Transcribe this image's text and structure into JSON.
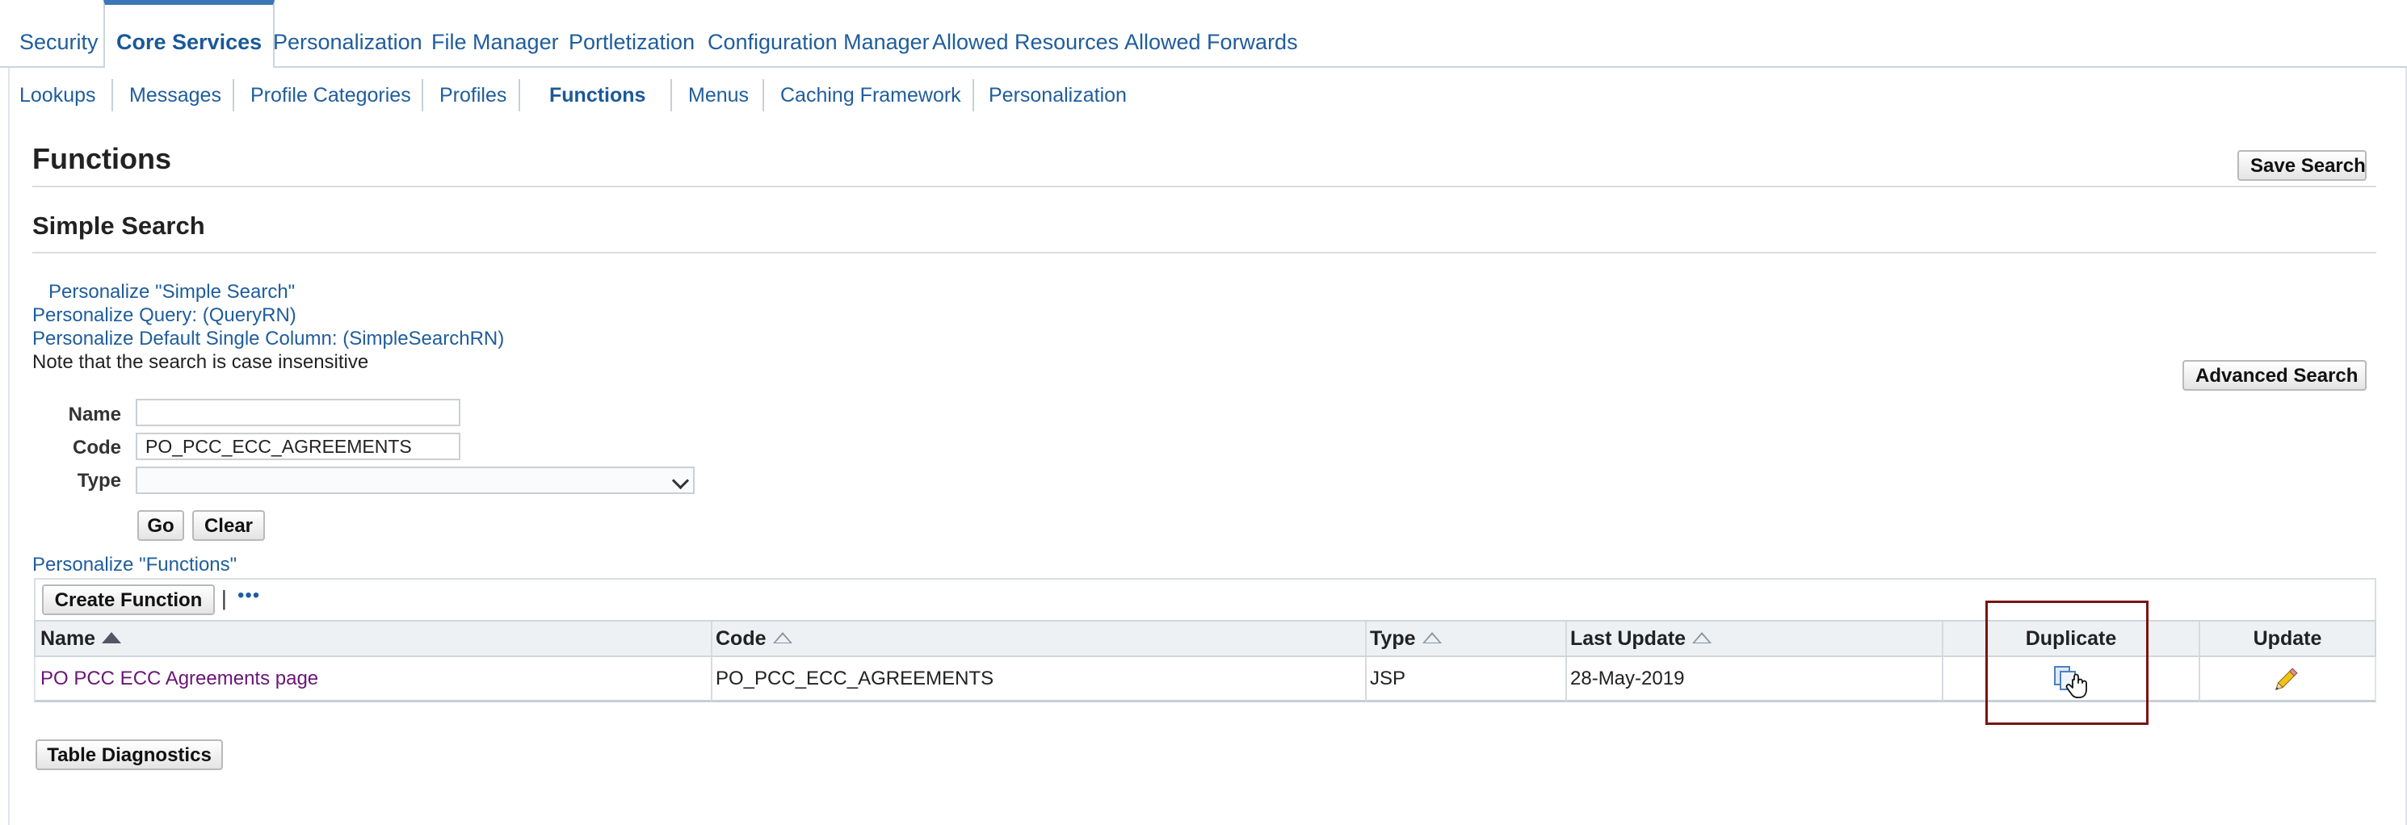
{
  "top_tabs": [
    "Security",
    "Core Services",
    "Personalization",
    "File Manager",
    "Portletization",
    "Configuration Manager",
    "Allowed Resources",
    "Allowed Forwards"
  ],
  "sub_tabs": [
    "Lookups",
    "Messages",
    "Profile Categories",
    "Profiles",
    "Functions",
    "Menus",
    "Caching Framework",
    "Personalization"
  ],
  "page": {
    "title": "Functions",
    "save_search_label": "Save Search",
    "section_title": "Simple Search",
    "personalize_simple_search": "Personalize \"Simple Search\"",
    "personalize_query": "Personalize Query: (QueryRN)",
    "personalize_default_single_column": "Personalize Default Single Column: (SimpleSearchRN)",
    "note": "Note that the search is case insensitive",
    "advanced_search_label": "Advanced Search"
  },
  "search_form": {
    "name_label": "Name",
    "name_value": "",
    "code_label": "Code",
    "code_value": "PO_PCC_ECC_AGREEMENTS",
    "type_label": "Type",
    "type_value": "",
    "go_label": "Go",
    "clear_label": "Clear"
  },
  "results": {
    "personalize_label": "Personalize \"Functions\"",
    "create_label": "Create Function",
    "toolbar_separator": "|",
    "more_glyph": "•••",
    "headers": {
      "name": "Name",
      "code": "Code",
      "type": "Type",
      "last_update": "Last Update",
      "duplicate": "Duplicate",
      "update": "Update"
    },
    "rows": [
      {
        "name": "PO PCC ECC Agreements page",
        "code": "PO_PCC_ECC_AGREEMENTS",
        "type": "JSP",
        "last_update": "28-May-2019"
      }
    ],
    "table_diagnostics_label": "Table Diagnostics"
  },
  "icons": {
    "duplicate": "duplicate-icon",
    "update": "pencil-icon",
    "sort_asc": "sort-ascending-icon",
    "sort_unsorted": "sort-icon"
  },
  "colors": {
    "link": "#1f5d9c",
    "visited_link": "#6b1577",
    "active_tab_accent": "#3b77b7",
    "highlight_box": "#7a1313"
  }
}
